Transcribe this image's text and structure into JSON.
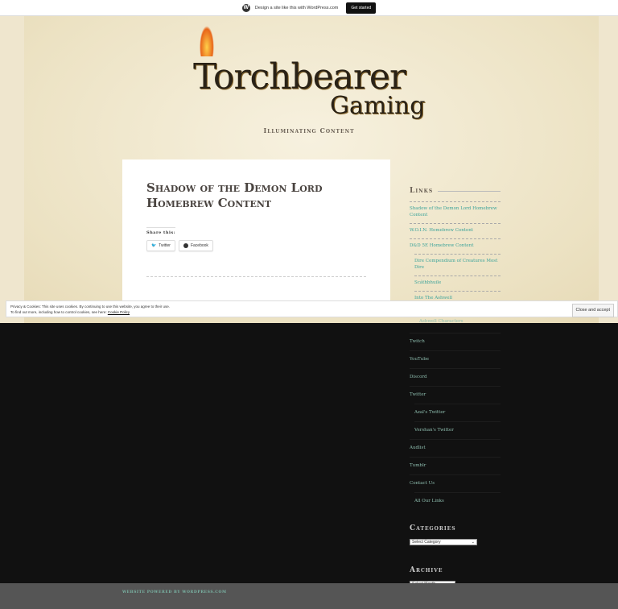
{
  "wpbar": {
    "text": "Design a site like this with WordPress.com",
    "cta": "Get started"
  },
  "site": {
    "logo_line1": "Torchbearer",
    "logo_line2": "Gaming",
    "tagline": "Illuminating Content"
  },
  "post": {
    "title": "Shadow of the Demon Lord Homebrew Content",
    "share_label": "Share this:",
    "share": [
      "Twitter",
      "Facebook"
    ]
  },
  "links": {
    "title": "Links",
    "items": [
      "Shadow of the Demon Lord Homebrew Content",
      "W.O.I.N. Homebrew Content",
      "D&D 5E Homebrew Content",
      "Dire Compendium of Creatures Most Dire",
      "Scáthbhuile",
      "Into The Ashwell",
      "Ashwell Characters",
      "Twitch",
      "YouTube",
      "Discord",
      "Twitter",
      "Azal's Twitter",
      "Vershan's Twitter",
      "Audlist",
      "Tumblr",
      "Contact Us",
      "All Our Links"
    ]
  },
  "categories": {
    "title": "Categories",
    "select": "Select Category"
  },
  "archive": {
    "title": "Archive",
    "select": "Select Month"
  },
  "cookie": {
    "line1": "Privacy & Cookies: This site uses cookies. By continuing to use this website, you agree to their use.",
    "line2": "To find out more, including how to control cookies, see here: ",
    "link": "Cookie Policy",
    "accept": "Close and accept"
  },
  "footer": {
    "text": "Website Powered by WordPress.com"
  }
}
